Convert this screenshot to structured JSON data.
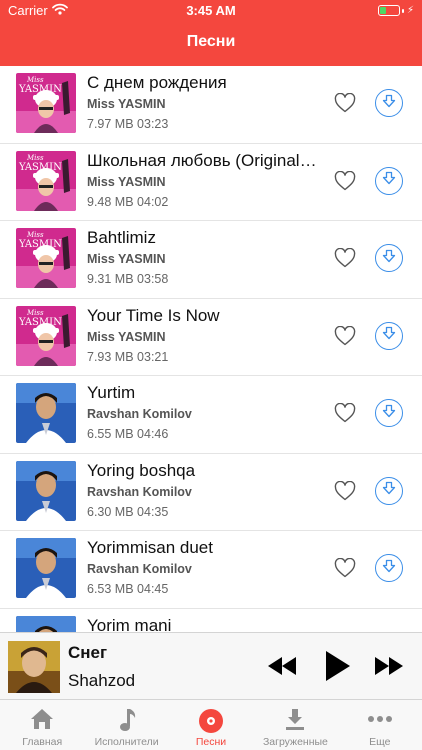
{
  "status_bar": {
    "carrier": "Carrier",
    "time": "3:45 AM"
  },
  "nav": {
    "title": "Песни"
  },
  "songs": [
    {
      "title": "С днем рождения",
      "artist": "Miss YASMIN",
      "size": "7.97 MB",
      "duration": "03:23",
      "cover": "yasmin"
    },
    {
      "title": "Школьная любовь (Original Mix)",
      "artist": "Miss YASMIN",
      "size": "9.48 MB",
      "duration": "04:02",
      "cover": "yasmin"
    },
    {
      "title": "Bahtlimiz",
      "artist": "Miss YASMIN",
      "size": "9.31 MB",
      "duration": "03:58",
      "cover": "yasmin"
    },
    {
      "title": "Your Time Is Now",
      "artist": "Miss YASMIN",
      "size": "7.93 MB",
      "duration": "03:21",
      "cover": "yasmin"
    },
    {
      "title": "Yurtim",
      "artist": "Ravshan Komilov",
      "size": "6.55 MB",
      "duration": "04:46",
      "cover": "ravshan"
    },
    {
      "title": "Yoring boshqa",
      "artist": "Ravshan Komilov",
      "size": "6.30 MB",
      "duration": "04:35",
      "cover": "ravshan"
    },
    {
      "title": "Yorimmisan duet",
      "artist": "Ravshan Komilov",
      "size": "6.53 MB",
      "duration": "04:45",
      "cover": "ravshan"
    },
    {
      "title": "Yorim mani",
      "artist": "",
      "size": "",
      "duration": "",
      "cover": "ravshan"
    }
  ],
  "cover_logo": {
    "line1": "Miss",
    "line2": "YASMIN"
  },
  "player": {
    "title": "Снег",
    "artist": "Shahzod"
  },
  "tabs": [
    {
      "label": "Главная",
      "icon": "home-icon",
      "active": false
    },
    {
      "label": "Исполнители",
      "icon": "music-note-icon",
      "active": false
    },
    {
      "label": "Песни",
      "icon": "record-icon",
      "active": true
    },
    {
      "label": "Загруженные",
      "icon": "download-tray-icon",
      "active": false
    },
    {
      "label": "Еще",
      "icon": "more-icon",
      "active": false
    }
  ],
  "colors": {
    "accent": "#f4473e",
    "download_blue": "#3b8ee8",
    "inactive_tab": "#8e8e8e"
  }
}
